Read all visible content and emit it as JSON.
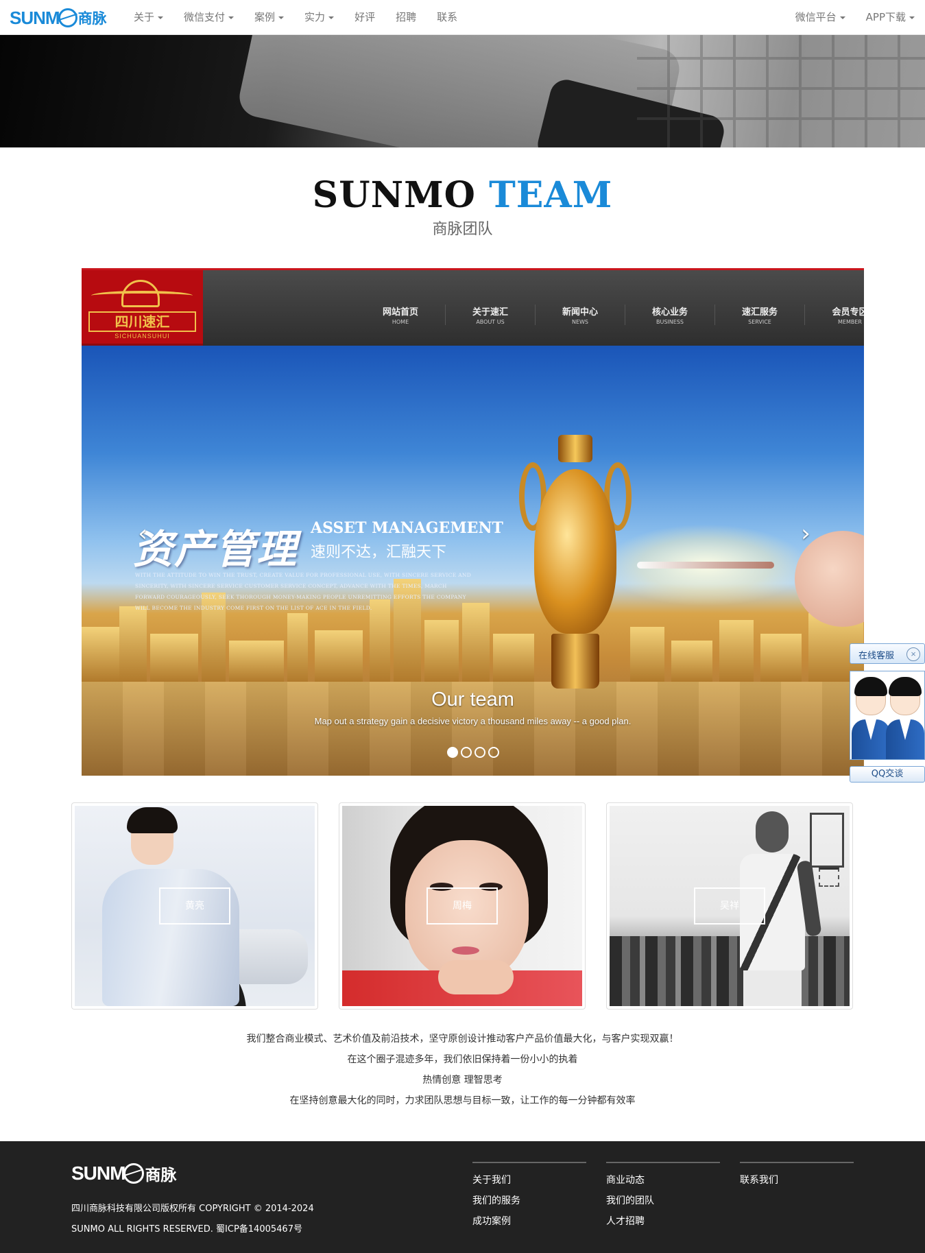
{
  "navbar": {
    "logo_text": "SUNM",
    "logo_cn": "商脉",
    "left_items": [
      {
        "label": "关于",
        "dropdown": true
      },
      {
        "label": "微信支付",
        "dropdown": true
      },
      {
        "label": "案例",
        "dropdown": true
      },
      {
        "label": "实力",
        "dropdown": true
      },
      {
        "label": "好评",
        "dropdown": false
      },
      {
        "label": "招聘",
        "dropdown": false
      },
      {
        "label": "联系",
        "dropdown": false
      }
    ],
    "right_items": [
      {
        "label": "微信平台",
        "dropdown": true
      },
      {
        "label": "APP下载",
        "dropdown": true
      }
    ]
  },
  "section_title": {
    "part1": "SUNMO",
    "part2": "TEAM",
    "subtitle": "商脉团队"
  },
  "carousel": {
    "slide": {
      "site_logo": "四川速汇",
      "site_logo_en": "SICHUANSUHUI",
      "menu": [
        {
          "cn": "网站首页",
          "en": "HOME"
        },
        {
          "cn": "关于速汇",
          "en": "ABOUT US"
        },
        {
          "cn": "新闻中心",
          "en": "NEWS"
        },
        {
          "cn": "核心业务",
          "en": "BUSINESS"
        },
        {
          "cn": "速汇服务",
          "en": "SERVICE"
        },
        {
          "cn": "会员专区",
          "en": "MEMBER"
        }
      ],
      "headline_cn": "资产管理",
      "headline_en": "ASSET MANAGEMENT",
      "headline_sub": "速则不达，汇融天下",
      "paragraph": "With the attitude to win the trust, create value for professional use, with sincere service and sincerity, with sincere service customer service concept, advance with the times, march forward courageously, seek thorough money-making people unremitting efforts the company will become the industry come first on the list of ace in the field."
    },
    "caption_title": "Our team",
    "caption_text": "Map out a strategy gain a decisive victory a thousand miles away -- a good plan.",
    "prev_icon": "‹",
    "next_icon": "›",
    "indicator_count": 4,
    "active_index": 0
  },
  "qq_widget": {
    "title": "在线客服",
    "close_icon": "×",
    "chat_label": "QQ交谈"
  },
  "team": [
    {
      "name": "黄亮"
    },
    {
      "name": "周梅"
    },
    {
      "name": "吴祥"
    }
  ],
  "description": [
    "我们整合商业模式、艺术价值及前沿技术，坚守原创设计推动客户产品价值最大化，与客户实现双赢！",
    "在这个圈子混迹多年，我们依旧保持着一份小小的执着",
    "热情创意 理智思考",
    "在坚持创意最大化的同时，力求团队思想与目标一致，让工作的每一分钟都有效率"
  ],
  "footer": {
    "logo_text": "SUNM",
    "logo_cn": "商脉",
    "copyright_line1": "四川商脉科技有限公司版权所有 COPYRIGHT © 2014-2024",
    "copyright_line2": "SUNMO ALL RIGHTS RESERVED. 蜀ICP备14005467号",
    "columns": [
      [
        "关于我们",
        "我们的服务",
        "成功案例"
      ],
      [
        "商业动态",
        "我们的团队",
        "人才招聘"
      ],
      [
        "联系我们"
      ]
    ]
  },
  "colors": {
    "accent": "#1a8ad8",
    "footer_bg": "#222222",
    "carousel_top_border": "#c9151c"
  }
}
